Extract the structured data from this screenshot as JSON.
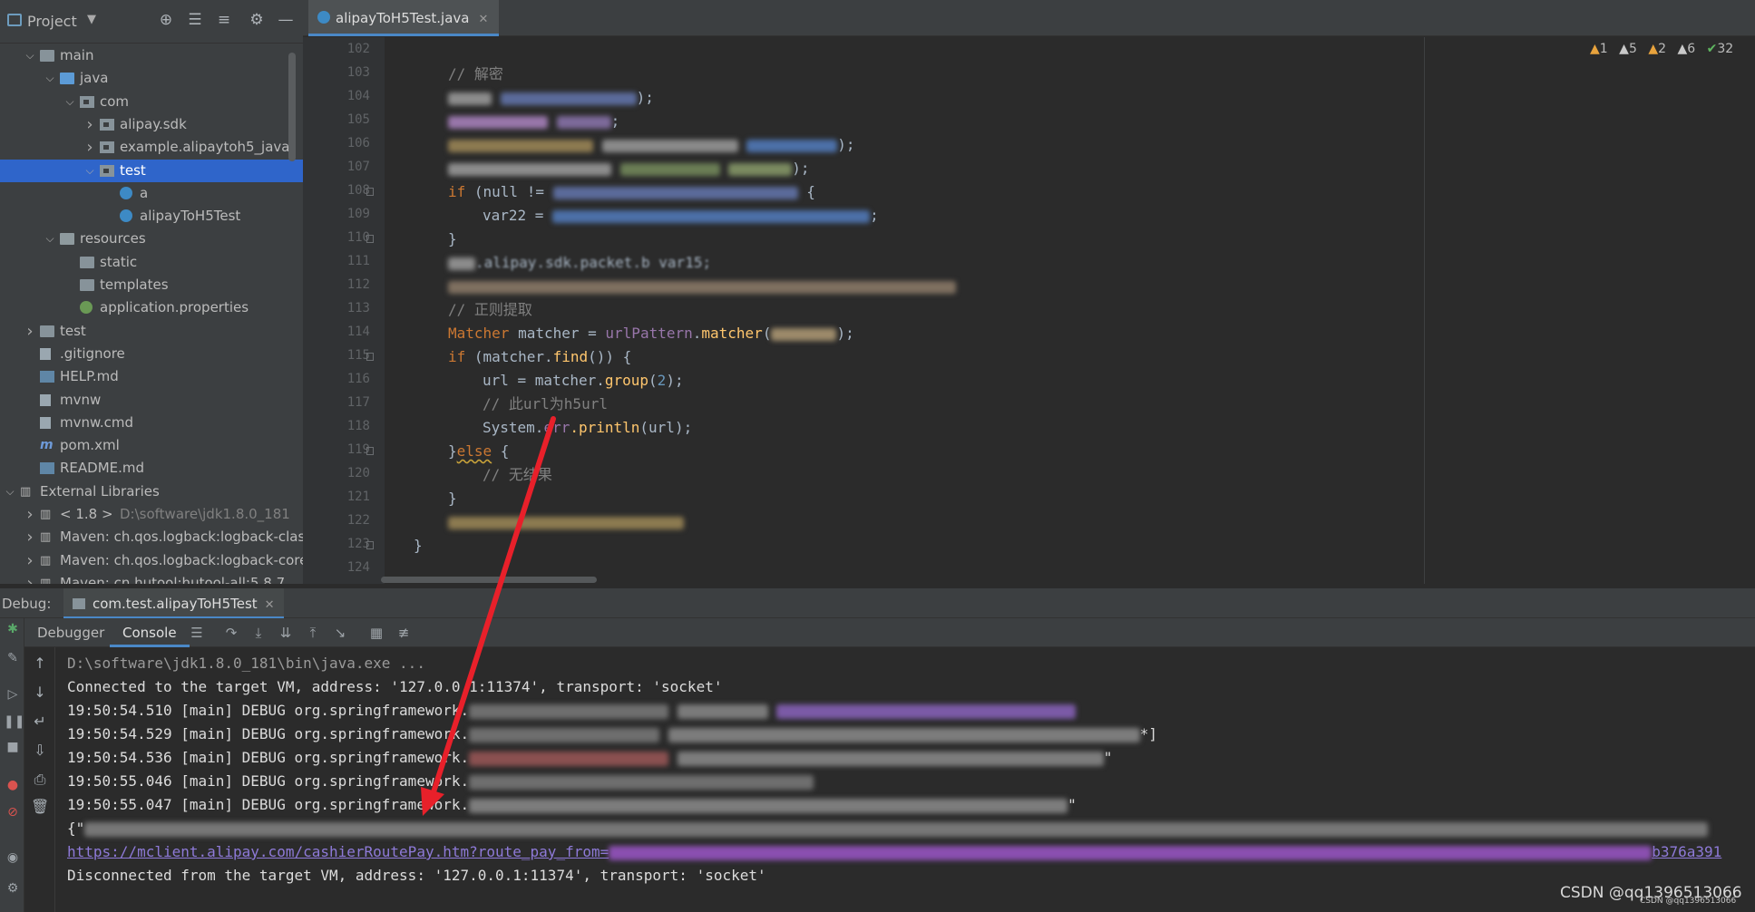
{
  "project_panel": {
    "title": "Project",
    "tree": [
      {
        "label": "main",
        "indent": 1,
        "arrow": "down",
        "icon": "folder"
      },
      {
        "label": "java",
        "indent": 2,
        "arrow": "down",
        "icon": "folder-blue"
      },
      {
        "label": "com",
        "indent": 3,
        "arrow": "down",
        "icon": "package"
      },
      {
        "label": "alipay.sdk",
        "indent": 4,
        "arrow": "right",
        "icon": "package"
      },
      {
        "label": "example.alipaytoh5_java",
        "indent": 4,
        "arrow": "right",
        "icon": "package"
      },
      {
        "label": "test",
        "indent": 4,
        "arrow": "down",
        "icon": "package",
        "selected": true
      },
      {
        "label": "a",
        "indent": 5,
        "arrow": "",
        "icon": "class"
      },
      {
        "label": "alipayToH5Test",
        "indent": 5,
        "arrow": "",
        "icon": "class"
      },
      {
        "label": "resources",
        "indent": 2,
        "arrow": "down",
        "icon": "folder-res"
      },
      {
        "label": "static",
        "indent": 3,
        "arrow": "",
        "icon": "folder"
      },
      {
        "label": "templates",
        "indent": 3,
        "arrow": "",
        "icon": "folder"
      },
      {
        "label": "application.properties",
        "indent": 3,
        "arrow": "",
        "icon": "properties"
      },
      {
        "label": "test",
        "indent": 1,
        "arrow": "right",
        "icon": "folder"
      },
      {
        "label": ".gitignore",
        "indent": 1,
        "arrow": "",
        "icon": "file"
      },
      {
        "label": "HELP.md",
        "indent": 1,
        "arrow": "",
        "icon": "md"
      },
      {
        "label": "mvnw",
        "indent": 1,
        "arrow": "",
        "icon": "file"
      },
      {
        "label": "mvnw.cmd",
        "indent": 1,
        "arrow": "",
        "icon": "file"
      },
      {
        "label": "pom.xml",
        "indent": 1,
        "arrow": "",
        "icon": "xml"
      },
      {
        "label": "README.md",
        "indent": 1,
        "arrow": "",
        "icon": "md"
      },
      {
        "label": "External Libraries",
        "indent": 0,
        "arrow": "down",
        "icon": "library"
      },
      {
        "label": "< 1.8 >",
        "hint": "D:\\software\\jdk1.8.0_181",
        "indent": 1,
        "arrow": "right",
        "icon": "library"
      },
      {
        "label": "Maven: ch.qos.logback:logback-classic:",
        "indent": 1,
        "arrow": "right",
        "icon": "library"
      },
      {
        "label": "Maven: ch.qos.logback:logback-core:1.2",
        "indent": 1,
        "arrow": "right",
        "icon": "library"
      },
      {
        "label": "Maven: cn.hutool:hutool-all:5.8.7",
        "indent": 1,
        "arrow": "right",
        "icon": "library"
      }
    ]
  },
  "editor": {
    "tab_label": "alipayToH5Test.java",
    "inspections": {
      "errors": "1",
      "warn_a": "5",
      "warn_b": "2",
      "warn_c": "6",
      "ok": "32"
    },
    "line_numbers": [
      "102",
      "103",
      "104",
      "105",
      "106",
      "107",
      "108",
      "109",
      "110",
      "111",
      "112",
      "113",
      "114",
      "115",
      "116",
      "117",
      "118",
      "119",
      "120",
      "121",
      "122",
      "123",
      "124"
    ],
    "code": {
      "c103": "// 解密",
      "c108_kw": "if",
      "c108_text": " (null != ",
      "c109_text": "var22 = ",
      "c110_text": "}",
      "c111_text": ".alipay.sdk.packet.b var15;",
      "c113": "// 正则提取",
      "c114_type": "Matcher",
      "c114_var": " matcher = ",
      "c114_field": "urlPattern",
      "c114_dot": ".",
      "c114_method": "matcher",
      "c114_end": ");",
      "c115_kw": "if",
      "c115_a": " (matcher.",
      "c115_m": "find",
      "c115_b": "()) {",
      "c116_a": "url = matcher.",
      "c116_m": "group",
      "c116_num": "2",
      "c116_end": ");",
      "c117": "// 此url为h5url",
      "c118_cls": "System.",
      "c118_f": "err",
      "c118_m": ".println",
      "c118_end": "(url);",
      "c119_brace": "}",
      "c119_kw": "else",
      "c119_end": " {",
      "c120": "// 无结果",
      "c121_text": "}",
      "c123_text": "}"
    }
  },
  "debug": {
    "label": "Debug:",
    "tab_label": "com.test.alipayToH5Test",
    "tabs": [
      "Debugger",
      "Console"
    ],
    "console_lines": [
      {
        "text": "D:\\software\\jdk1.8.0_181\\bin\\java.exe ...",
        "style": "dim"
      },
      {
        "text": "Connected to the target VM, address: '127.0.0.1:11374', transport: 'socket'",
        "style": "normal"
      },
      {
        "text": "19:50:54.510 [main] DEBUG org.springframework.",
        "style": "normal"
      },
      {
        "text": "19:50:54.529 [main] DEBUG org.springframework.",
        "style": "normal"
      },
      {
        "text": "19:50:54.536 [main] DEBUG org.springframework.",
        "style": "normal"
      },
      {
        "text": "19:50:55.046 [main] DEBUG org.springframework.",
        "style": "normal"
      },
      {
        "text": "19:50:55.047 [main] DEBUG org.springframework.",
        "style": "normal"
      },
      {
        "text": "{\"",
        "style": "normal"
      },
      {
        "text": "https://mclient.alipay.com/cashierRoutePay.htm?route_pay_from=",
        "style": "link"
      },
      {
        "text": "Disconnected from the target VM, address: '127.0.0.1:11374', transport: 'socket'",
        "style": "normal"
      }
    ],
    "tail_fragments": {
      "line4_end": "*]",
      "line5_end": "\"",
      "line7_end": "\"",
      "link_end": "b376a391"
    }
  },
  "watermark": "CSDN @qq1396513066",
  "watermark_small": "CSDN @qq1396513066",
  "colors": {
    "selection": "#2f65ca",
    "keyword": "#cc7832",
    "method": "#ffc66d",
    "field": "#9876aa",
    "comment": "#808080",
    "link": "#8e7ad8",
    "annotation_arrow": "#e8202a"
  }
}
